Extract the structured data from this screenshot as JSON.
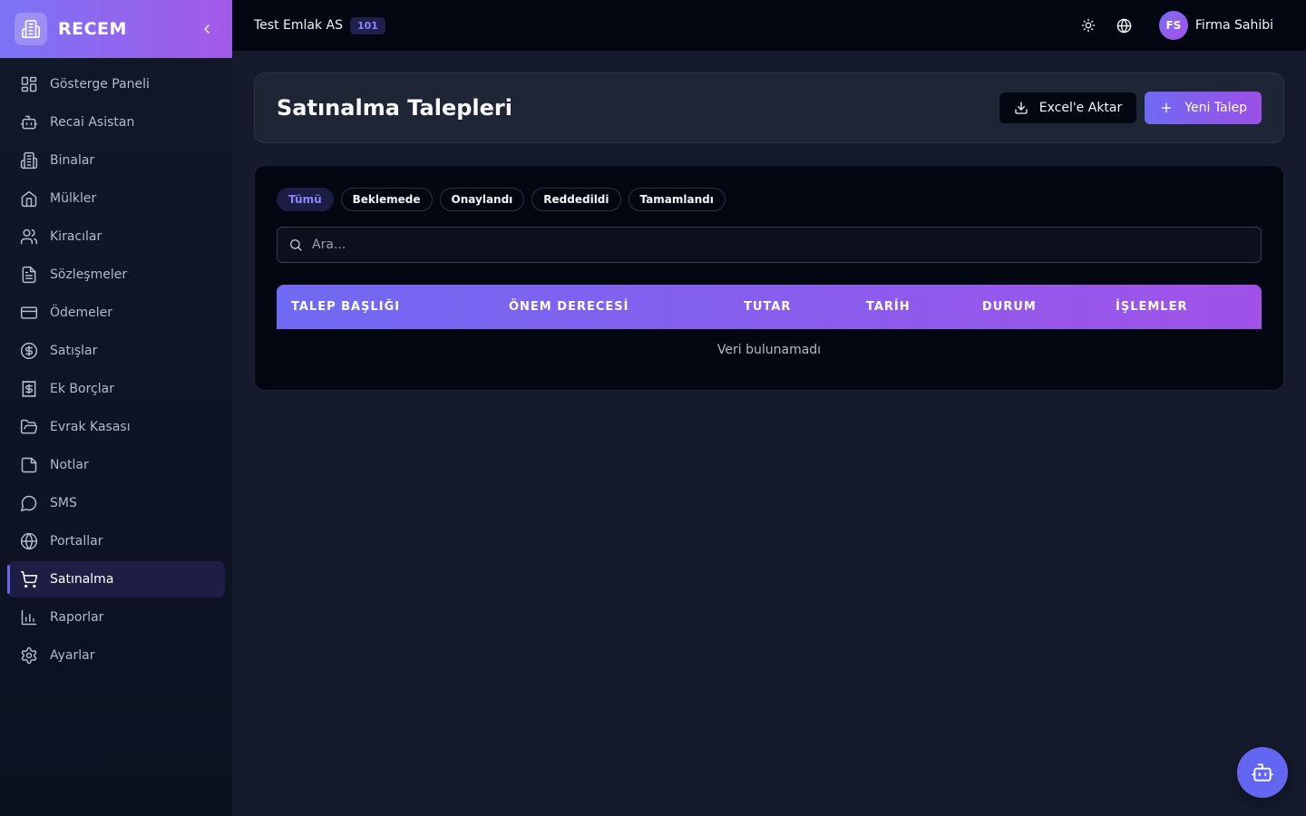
{
  "brand": {
    "name": "RECEM"
  },
  "sidebar": {
    "items": [
      {
        "label": "Gösterge Paneli",
        "icon": "dashboard-icon"
      },
      {
        "label": "Recai Asistan",
        "icon": "bot-icon"
      },
      {
        "label": "Binalar",
        "icon": "building-icon"
      },
      {
        "label": "Mülkler",
        "icon": "home-icon"
      },
      {
        "label": "Kiracılar",
        "icon": "users-icon"
      },
      {
        "label": "Sözleşmeler",
        "icon": "file-text-icon"
      },
      {
        "label": "Ödemeler",
        "icon": "credit-card-icon"
      },
      {
        "label": "Satışlar",
        "icon": "dollar-circle-icon"
      },
      {
        "label": "Ek Borçlar",
        "icon": "receipt-icon"
      },
      {
        "label": "Evrak Kasası",
        "icon": "folder-open-icon"
      },
      {
        "label": "Notlar",
        "icon": "sticky-note-icon"
      },
      {
        "label": "SMS",
        "icon": "message-icon"
      },
      {
        "label": "Portallar",
        "icon": "globe-icon"
      },
      {
        "label": "Satınalma",
        "icon": "shopping-cart-icon",
        "active": true
      },
      {
        "label": "Raporlar",
        "icon": "bar-chart-icon"
      },
      {
        "label": "Ayarlar",
        "icon": "gear-icon"
      }
    ]
  },
  "topbar": {
    "company": "Test Emlak AS",
    "company_badge": "101",
    "user_initials": "FS",
    "user_name": "Firma Sahibi"
  },
  "main": {
    "title": "Satınalma Talepleri",
    "export_label": "Excel'e Aktar",
    "new_label": "Yeni Talep",
    "filters": [
      "Tümü",
      "Beklemede",
      "Onaylandı",
      "Reddedildi",
      "Tamamlandı"
    ],
    "active_filter": "Tümü",
    "search_placeholder": "Ara...",
    "table": {
      "columns": [
        "TALEP BAŞLIĞI",
        "ÖNEM DERECESİ",
        "TUTAR",
        "TARİH",
        "DURUM",
        "İŞLEMLER"
      ],
      "empty_text": "Veri bulunamadı"
    }
  },
  "colors": {
    "accent": "#6366f1",
    "accent_purple": "#a855f7",
    "background": "#151b2c",
    "sidebar": "#0f1526"
  }
}
